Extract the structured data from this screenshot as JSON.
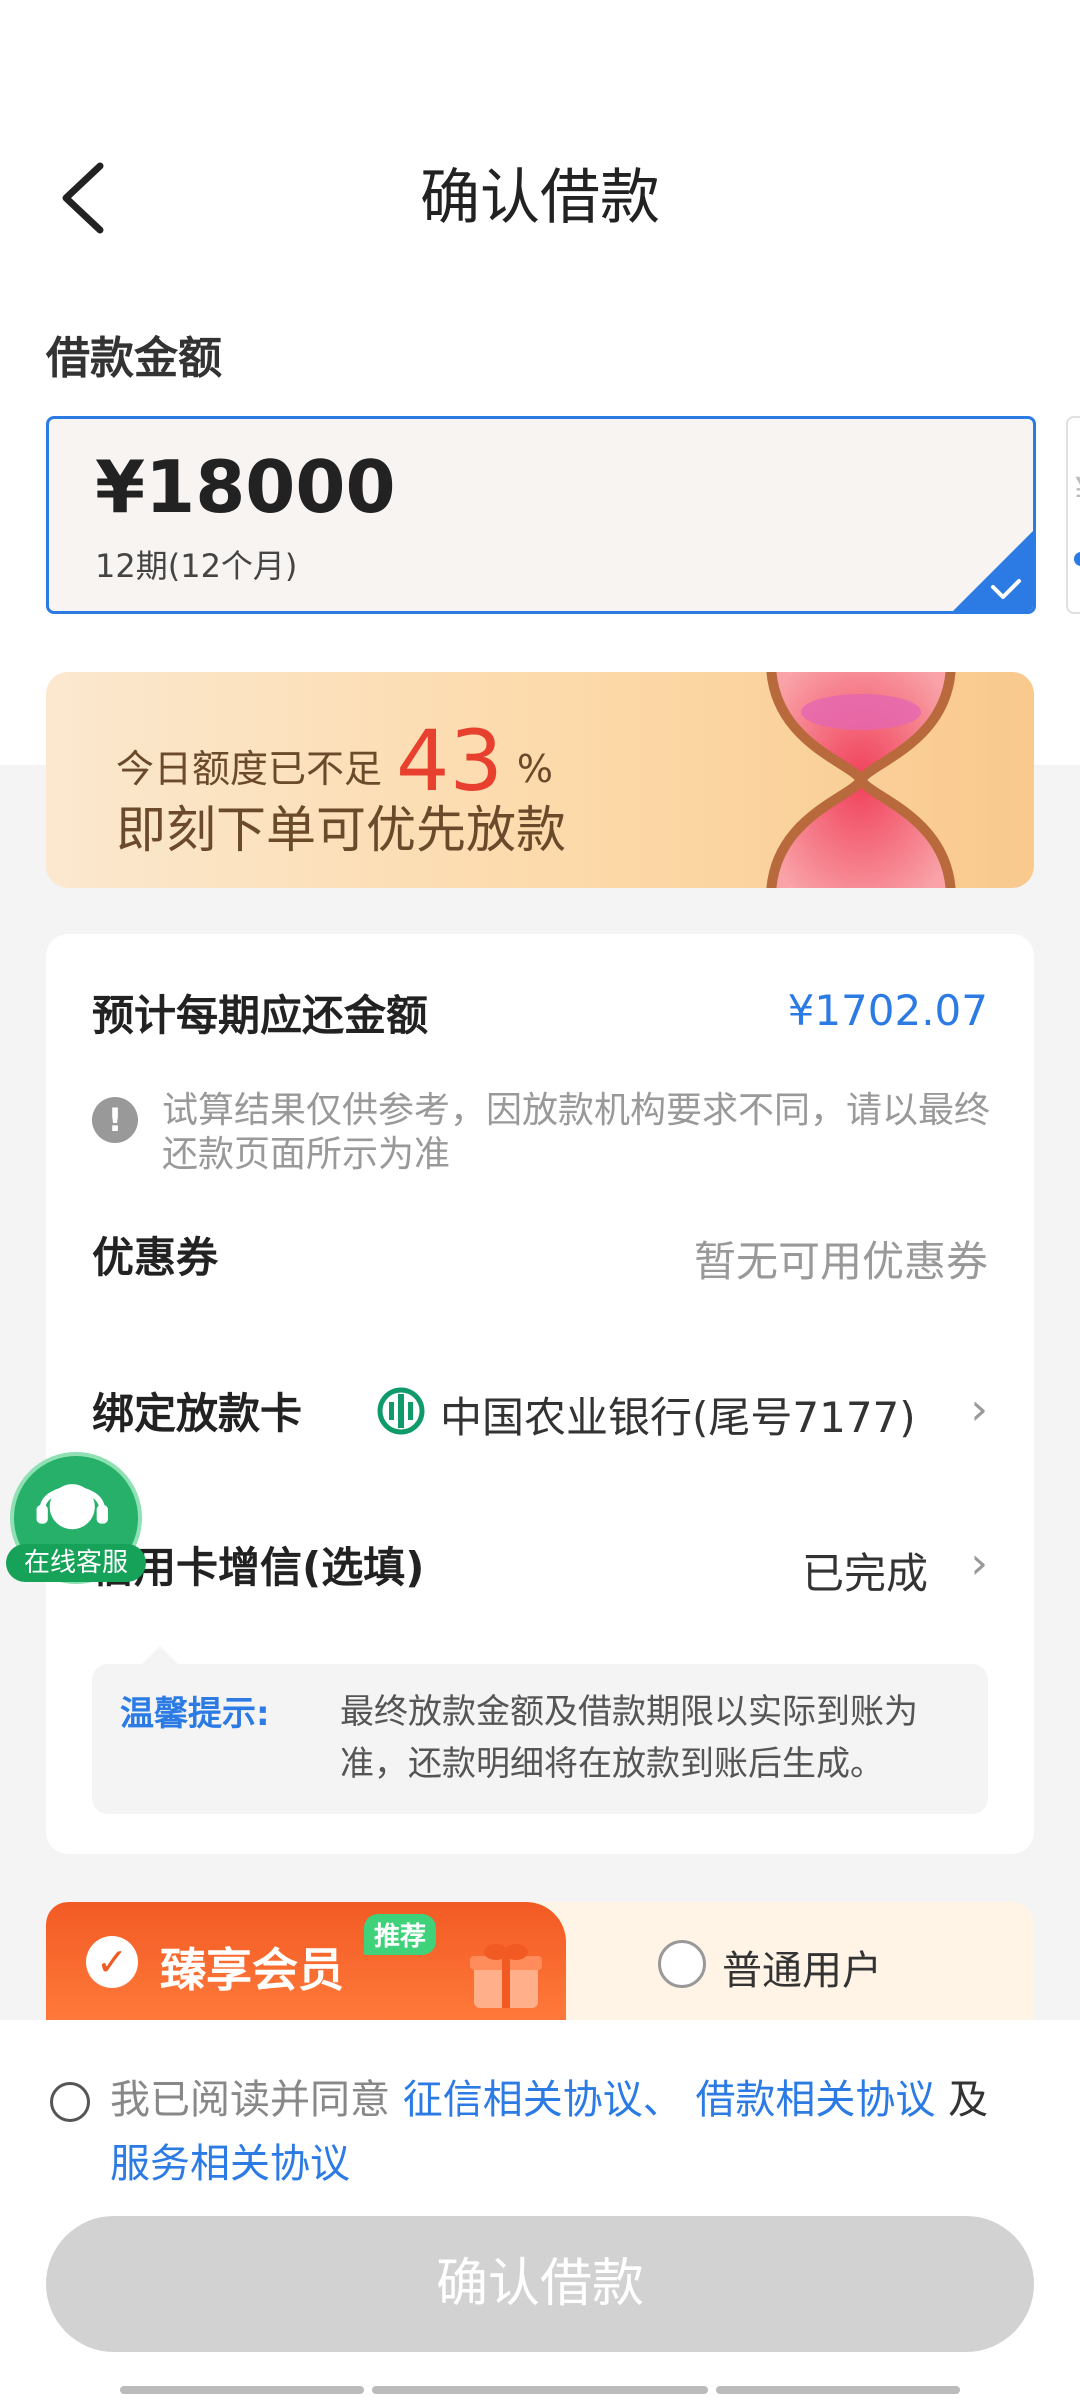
{
  "header": {
    "title": "确认借款"
  },
  "loan": {
    "section_label": "借款金额",
    "amount": "¥18000",
    "term": "12期(12个月)",
    "peek_symbol": "¥"
  },
  "banner": {
    "line1_prefix": "今日额度已不足",
    "percent_value": "43",
    "percent_sign": "%",
    "line2": "即刻下单可优先放款"
  },
  "details": {
    "repay_label": "预计每期应还金额",
    "repay_value": "¥1702.07",
    "note": "试算结果仅供参考，因放款机构要求不同，请以最终还款页面所示为准",
    "coupon_label": "优惠券",
    "coupon_value": "暂无可用优惠券",
    "card_label": "绑定放款卡",
    "card_value": "中国农业银行(尾号7177)",
    "credit_label": "信用卡增信(选填)",
    "credit_value": "已完成",
    "tip_label": "温馨提示:",
    "tip_text": "最终放款金额及借款期限以实际到账为准，还款明细将在放款到账后生成。"
  },
  "service": {
    "label": "在线客服"
  },
  "membership": {
    "vip_name": "臻享会员",
    "vip_tag": "推荐",
    "normal_name": "普通用户"
  },
  "agreement": {
    "prefix": "我已阅读并同意",
    "link1": "征信相关协议、",
    "link2": "借款相关协议",
    "conj": "及",
    "link3": "服务相关协议"
  },
  "confirm_button": "确认借款",
  "colors": {
    "accent": "#2c7be5",
    "warning": "#e8402e",
    "vip": "#f25a24"
  }
}
